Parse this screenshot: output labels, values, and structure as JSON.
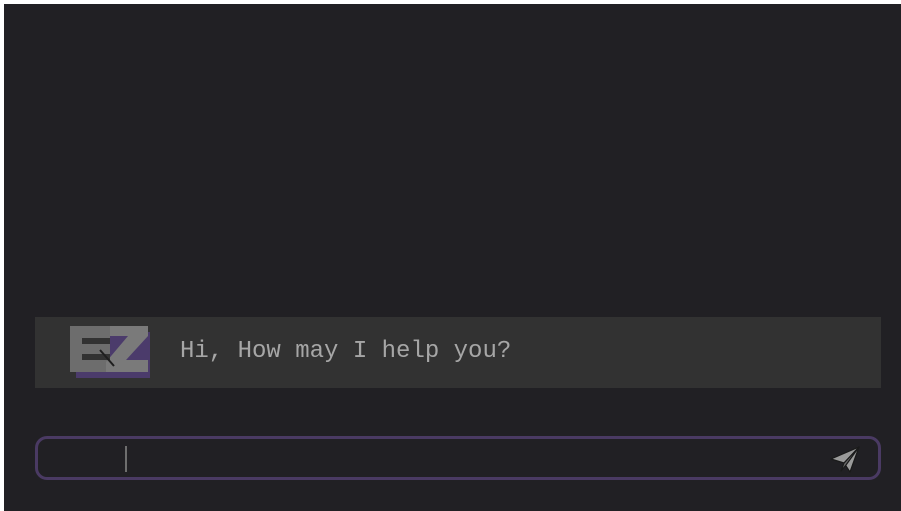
{
  "chat": {
    "messages": [
      {
        "sender": "bot",
        "avatar_icon": "ez-logo-icon",
        "logo_text": "EZ",
        "text": "Hi, How may I help you?"
      }
    ],
    "input": {
      "value": "",
      "placeholder": ""
    },
    "send_icon": "paper-plane-icon"
  },
  "colors": {
    "background": "#212024",
    "message_background": "#323232",
    "message_text": "#a6a6a6",
    "input_border": "#4a3a63",
    "logo_grey": "#8a8a8a",
    "logo_purple": "#4b3b6b"
  }
}
